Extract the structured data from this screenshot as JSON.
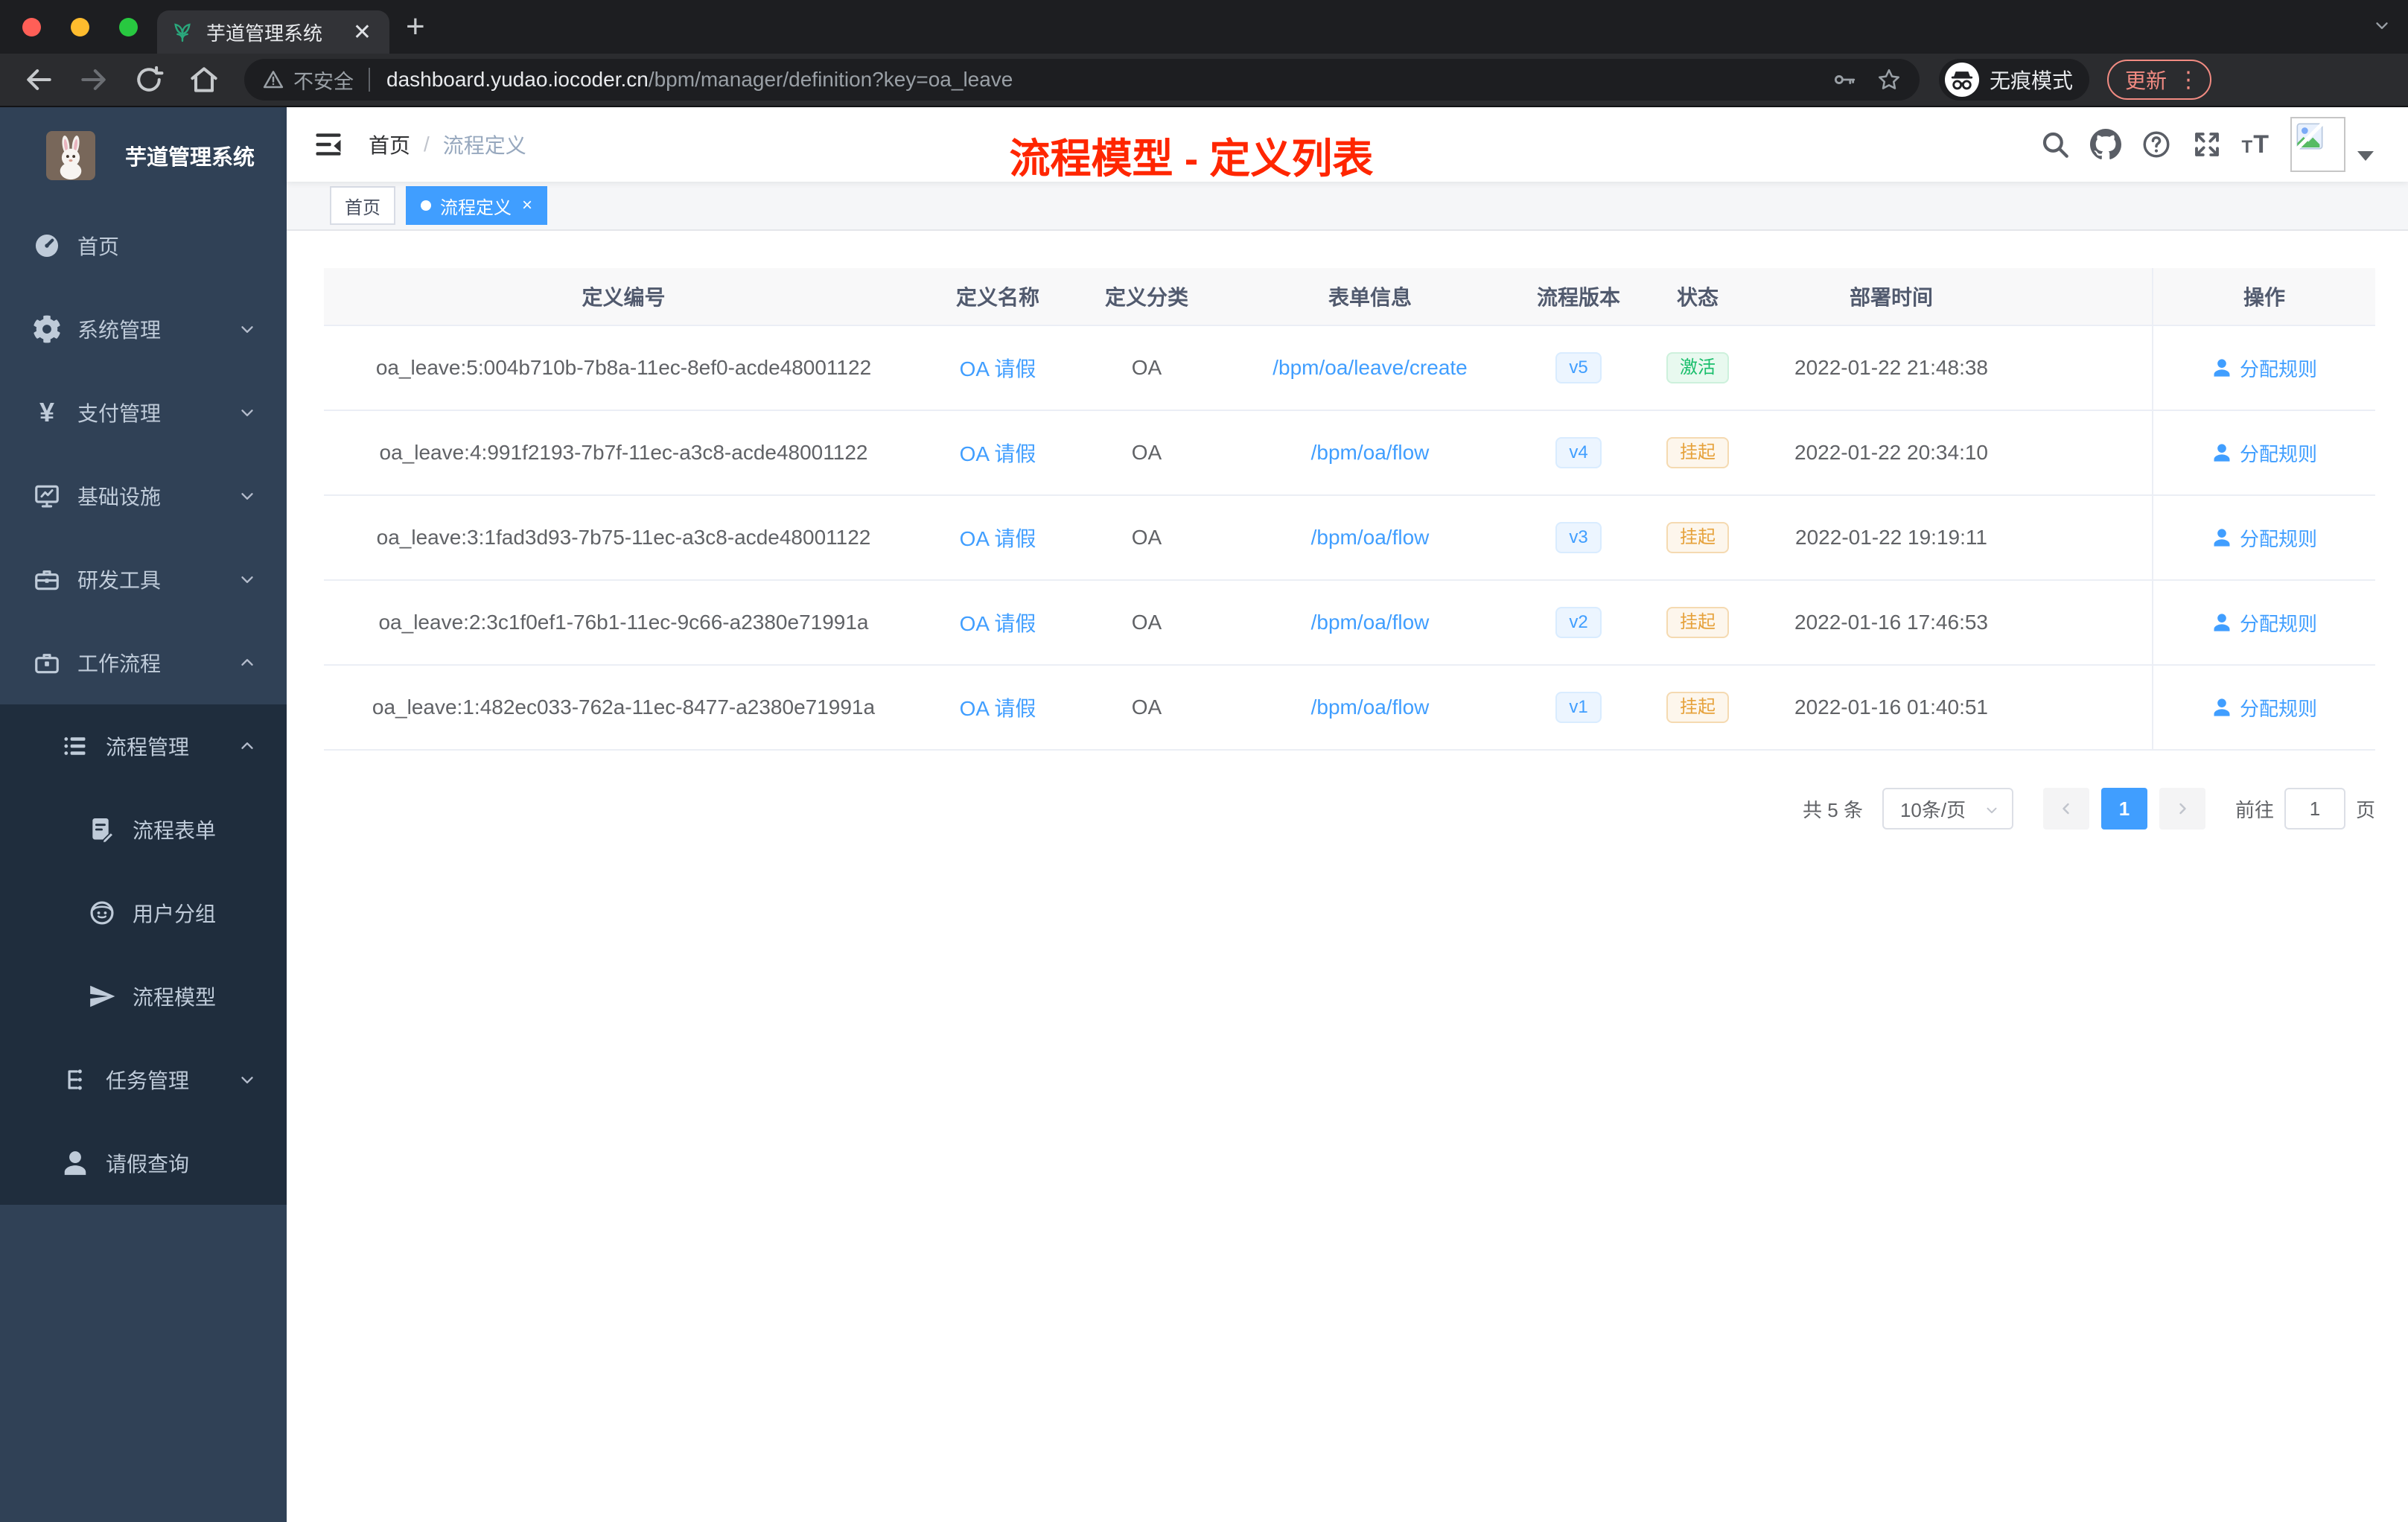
{
  "colors": {
    "accent": "#409eff",
    "success": "#19be6b",
    "warning": "#e6a23c",
    "annotation": "#ff2600"
  },
  "browser": {
    "tab": {
      "title": "芋道管理系统",
      "favicon": "plant-icon"
    },
    "toolbar": {
      "security_label": "不安全",
      "url_host": "dashboard.yudao.iocoder.cn",
      "url_path": "/bpm/manager/definition?key=oa_leave",
      "incognito_label": "无痕模式",
      "update_label": "更新"
    }
  },
  "sidebar": {
    "logo_title": "芋道管理系统",
    "menu": [
      {
        "name": "home",
        "label": "首页",
        "icon": "dashboard-icon",
        "level": 0,
        "dark": false
      },
      {
        "name": "system-management",
        "label": "系统管理",
        "icon": "gear-icon",
        "level": 0,
        "dark": false,
        "arrow": "down"
      },
      {
        "name": "payment-management",
        "label": "支付管理",
        "icon": "yen-icon",
        "level": 0,
        "dark": false,
        "arrow": "down"
      },
      {
        "name": "infrastructure",
        "label": "基础设施",
        "icon": "monitor-icon",
        "level": 0,
        "dark": false,
        "arrow": "down"
      },
      {
        "name": "dev-tools",
        "label": "研发工具",
        "icon": "toolbox-icon",
        "level": 0,
        "dark": false,
        "arrow": "down"
      },
      {
        "name": "workflow",
        "label": "工作流程",
        "icon": "briefcase-icon",
        "level": 0,
        "dark": false,
        "arrow": "up"
      },
      {
        "name": "process-management",
        "label": "流程管理",
        "icon": "tree-list-icon",
        "level": 1,
        "dark": true,
        "arrow": "up"
      },
      {
        "name": "process-form",
        "label": "流程表单",
        "icon": "form-icon",
        "level": 2,
        "dark": true
      },
      {
        "name": "user-group",
        "label": "用户分组",
        "icon": "user-group-icon",
        "level": 2,
        "dark": true
      },
      {
        "name": "process-model",
        "label": "流程模型",
        "icon": "paper-plane-icon",
        "level": 2,
        "dark": true
      },
      {
        "name": "task-management",
        "label": "任务管理",
        "icon": "org-tree-icon",
        "level": 1,
        "dark": true,
        "arrow": "down"
      },
      {
        "name": "leave-query",
        "label": "请假查询",
        "icon": "person-icon",
        "level": 1,
        "dark": true
      }
    ]
  },
  "header": {
    "breadcrumb": [
      "首页",
      "流程定义"
    ],
    "annotation": "流程模型 - 定义列表",
    "right_icons": [
      "search-icon",
      "github-icon",
      "question-icon",
      "fullscreen-icon",
      "font-size-icon"
    ]
  },
  "tags": [
    {
      "label": "首页",
      "active": false
    },
    {
      "label": "流程定义",
      "active": true,
      "closable": true
    }
  ],
  "table": {
    "columns": [
      "定义编号",
      "定义名称",
      "定义分类",
      "表单信息",
      "流程版本",
      "状态",
      "部署时间",
      "操作"
    ],
    "rows": [
      {
        "id": "oa_leave:5:004b710b-7b8a-11ec-8ef0-acde48001122",
        "name": "OA 请假",
        "category": "OA",
        "form": "/bpm/oa/leave/create",
        "version": "v5",
        "status": "激活",
        "status_type": "success",
        "deploy_time": "2022-01-22 21:48:38",
        "action": "分配规则"
      },
      {
        "id": "oa_leave:4:991f2193-7b7f-11ec-a3c8-acde48001122",
        "name": "OA 请假",
        "category": "OA",
        "form": "/bpm/oa/flow",
        "version": "v4",
        "status": "挂起",
        "status_type": "warning",
        "deploy_time": "2022-01-22 20:34:10",
        "action": "分配规则"
      },
      {
        "id": "oa_leave:3:1fad3d93-7b75-11ec-a3c8-acde48001122",
        "name": "OA 请假",
        "category": "OA",
        "form": "/bpm/oa/flow",
        "version": "v3",
        "status": "挂起",
        "status_type": "warning",
        "deploy_time": "2022-01-22 19:19:11",
        "action": "分配规则"
      },
      {
        "id": "oa_leave:2:3c1f0ef1-76b1-11ec-9c66-a2380e71991a",
        "name": "OA 请假",
        "category": "OA",
        "form": "/bpm/oa/flow",
        "version": "v2",
        "status": "挂起",
        "status_type": "warning",
        "deploy_time": "2022-01-16 17:46:53",
        "action": "分配规则"
      },
      {
        "id": "oa_leave:1:482ec033-762a-11ec-8477-a2380e71991a",
        "name": "OA 请假",
        "category": "OA",
        "form": "/bpm/oa/flow",
        "version": "v1",
        "status": "挂起",
        "status_type": "warning",
        "deploy_time": "2022-01-16 01:40:51",
        "action": "分配规则"
      }
    ]
  },
  "pagination": {
    "total_label": "共 5 条",
    "page_size_label": "10条/页",
    "current_page": "1",
    "goto_label": "前往",
    "goto_value": "1",
    "page_unit": "页"
  }
}
